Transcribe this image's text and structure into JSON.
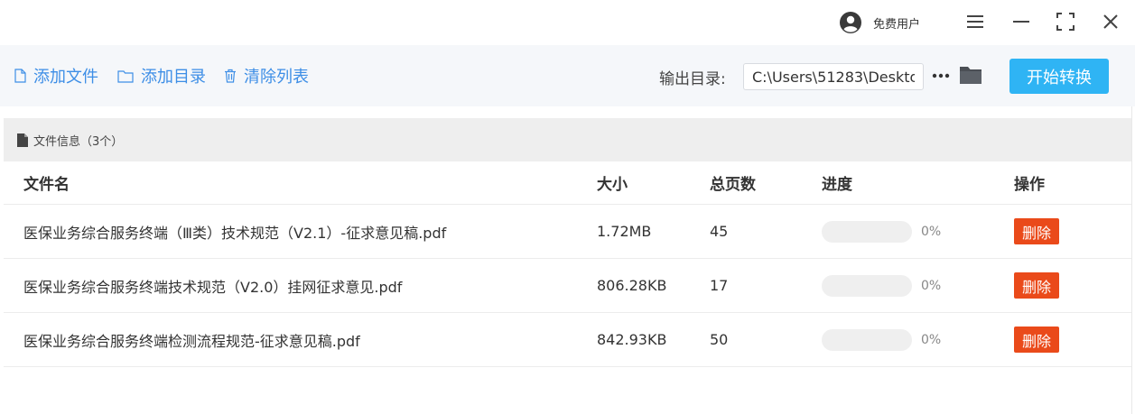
{
  "titlebar": {
    "user_name": "免费用户",
    "icons": [
      "user-avatar-icon",
      "menu-icon",
      "minimize-icon",
      "maximize-icon",
      "close-icon"
    ]
  },
  "toolbar": {
    "add_file_label": "添加文件",
    "add_folder_label": "添加目录",
    "clear_list_label": "清除列表",
    "output_dir_label": "输出目录:",
    "output_dir_value": "C:\\Users\\51283\\Deskto",
    "start_label": "开始转换"
  },
  "panel": {
    "title": "文件信息（3个）"
  },
  "table": {
    "headers": {
      "name": "文件名",
      "size": "大小",
      "pages": "总页数",
      "progress": "进度",
      "action": "操作"
    },
    "rows": [
      {
        "name": "医保业务综合服务终端（Ⅲ类）技术规范（V2.1）-征求意见稿.pdf",
        "size": "1.72MB",
        "pages": "45",
        "progress_text": "0%",
        "progress": 0,
        "action": "删除"
      },
      {
        "name": "医保业务综合服务终端技术规范（V2.0）挂网征求意见.pdf",
        "size": "806.28KB",
        "pages": "17",
        "progress_text": "0%",
        "progress": 0,
        "action": "删除"
      },
      {
        "name": "医保业务综合服务终端检测流程规范-征求意见稿.pdf",
        "size": "842.93KB",
        "pages": "50",
        "progress_text": "0%",
        "progress": 0,
        "action": "删除"
      }
    ]
  },
  "colors": {
    "accent": "#2fb4f4",
    "link": "#3d8ee6",
    "danger": "#ea4a1a"
  }
}
